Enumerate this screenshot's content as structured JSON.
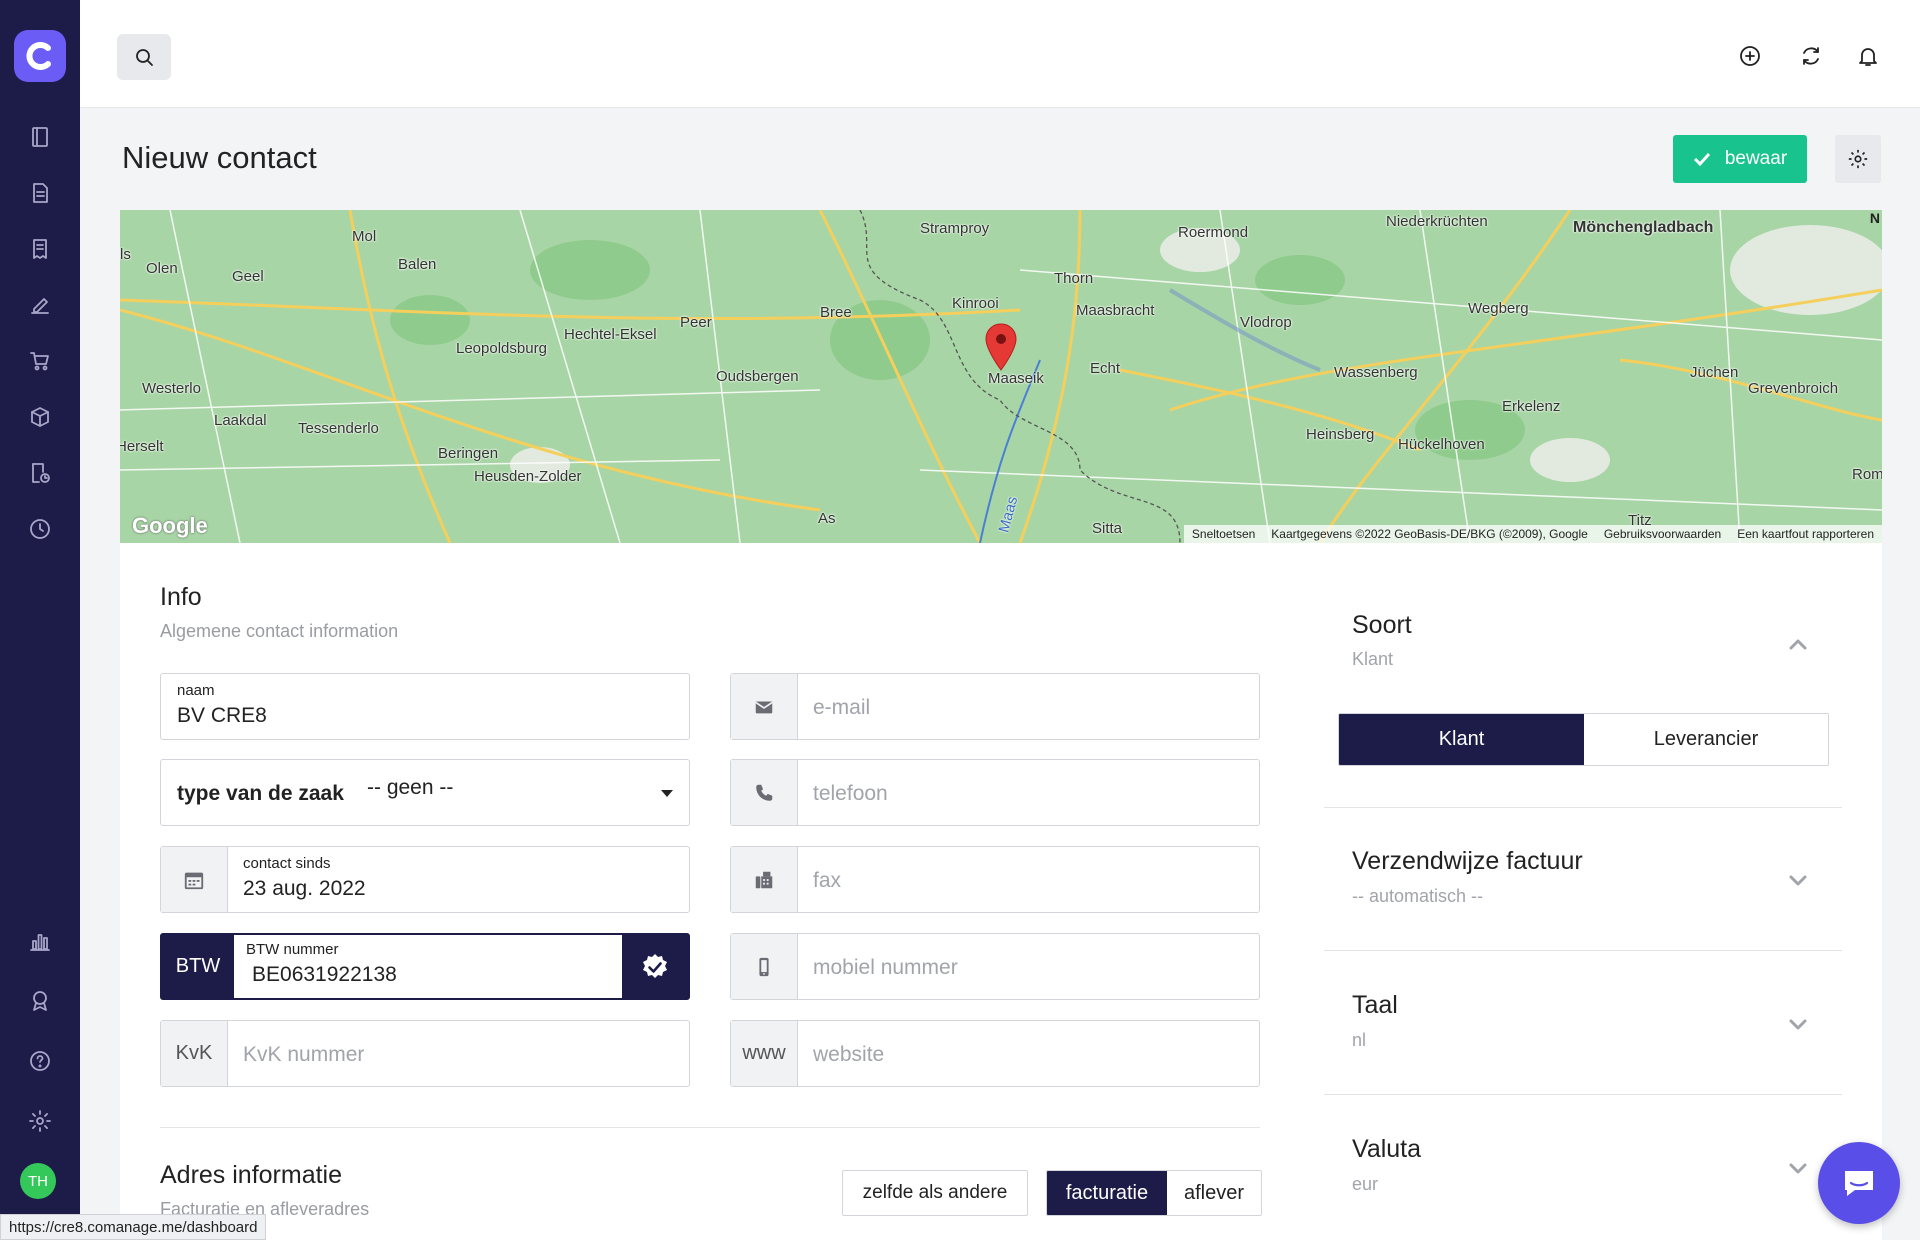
{
  "sidebar": {
    "logo_letter": "C",
    "items": [
      {
        "icon": "book-icon"
      },
      {
        "icon": "document-icon"
      },
      {
        "icon": "receipt-icon"
      },
      {
        "icon": "edit-icon"
      },
      {
        "icon": "cart-icon"
      },
      {
        "icon": "box-icon"
      },
      {
        "icon": "invoice-clock-icon"
      },
      {
        "icon": "clock-icon"
      },
      {
        "icon": "chart-icon"
      },
      {
        "icon": "badge-icon"
      },
      {
        "icon": "help-icon"
      },
      {
        "icon": "gear-icon"
      }
    ],
    "avatar_initials": "TH"
  },
  "page": {
    "title": "Nieuw contact",
    "save_label": "bewaar"
  },
  "map": {
    "labels": [
      "Mol",
      "Olen",
      "Geel",
      "Balen",
      "Leopoldsburg",
      "Hechtel-Eksel",
      "Peer",
      "Bree",
      "Stramproy",
      "Roermond",
      "Niederkrüchten",
      "Mönchengladbach",
      "Kinrooi",
      "Thorn",
      "Maasbracht",
      "Vlodrop",
      "Wegberg",
      "Westerlo",
      "Laakdal",
      "Tessenderlo",
      "Beringen",
      "Heusden-Zolder",
      "Oudsbergen",
      "Maaseik",
      "Echt",
      "Wassenberg",
      "Jüchen",
      "Grevenbroich",
      "Erkelenz",
      "Heinsberg",
      "Hückelhoven",
      "Herselt",
      "As",
      "Sitta",
      "Romm",
      "Maas",
      "ls",
      "Titz"
    ],
    "footer": [
      "Sneltoetsen",
      "Kaartgegevens ©2022 GeoBasis-DE/BKG (©2009), Google",
      "Gebruiksvoorwaarden",
      "Een kaartfout rapporteren"
    ],
    "google": "Google",
    "north": "N"
  },
  "info": {
    "title": "Info",
    "subtitle": "Algemene contact information",
    "naam_label": "naam",
    "naam_value": "BV CRE8",
    "type_label": "type van de zaak",
    "type_value": "-- geen --",
    "contact_since_label": "contact sinds",
    "contact_since_value": "23 aug. 2022",
    "btw_prefix": "BTW",
    "btw_label": "BTW nummer",
    "btw_value": "BE0631922138",
    "kvk_prefix": "KvK",
    "kvk_placeholder": "KvK nummer",
    "email_placeholder": "e-mail",
    "phone_placeholder": "telefoon",
    "fax_placeholder": "fax",
    "mobile_placeholder": "mobiel nummer",
    "www_prefix": "www",
    "website_placeholder": "website"
  },
  "address": {
    "title": "Adres informatie",
    "subtitle": "Facturatie en afleveradres",
    "same_label": "zelfde als andere",
    "billing_label": "facturatie",
    "delivery_label": "aflever"
  },
  "right": {
    "soort_title": "Soort",
    "soort_value": "Klant",
    "klant_label": "Klant",
    "leverancier_label": "Leverancier",
    "verzend_title": "Verzendwijze factuur",
    "verzend_value": "-- automatisch --",
    "taal_title": "Taal",
    "taal_value": "nl",
    "valuta_title": "Valuta",
    "valuta_value": "eur"
  },
  "status_url": "https://cre8.comanage.me/dashboard",
  "colors": {
    "sidebar": "#1d1b48",
    "accent": "#6b5cf6",
    "save": "#19c38d",
    "map_green": "#a8d5a6"
  }
}
